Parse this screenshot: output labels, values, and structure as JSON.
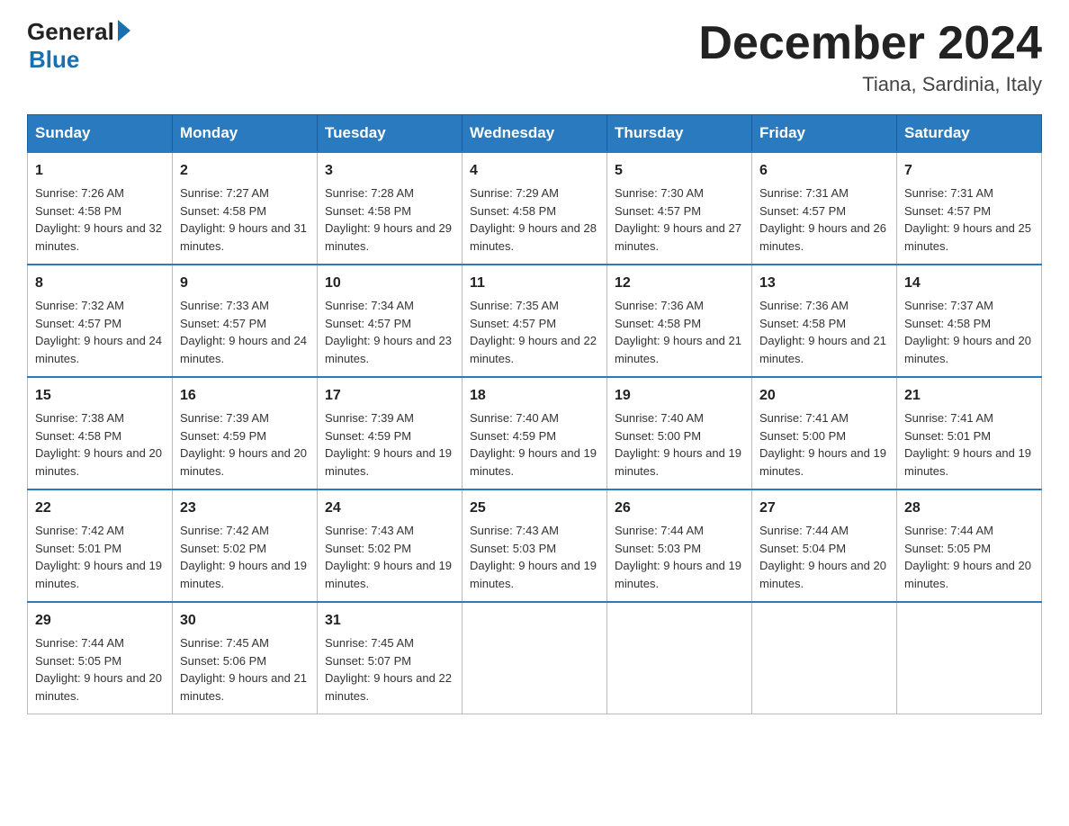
{
  "header": {
    "logo_general": "General",
    "logo_blue": "Blue",
    "month_title": "December 2024",
    "location": "Tiana, Sardinia, Italy"
  },
  "weekdays": [
    "Sunday",
    "Monday",
    "Tuesday",
    "Wednesday",
    "Thursday",
    "Friday",
    "Saturday"
  ],
  "weeks": [
    [
      {
        "day": "1",
        "sunrise": "Sunrise: 7:26 AM",
        "sunset": "Sunset: 4:58 PM",
        "daylight": "Daylight: 9 hours and 32 minutes."
      },
      {
        "day": "2",
        "sunrise": "Sunrise: 7:27 AM",
        "sunset": "Sunset: 4:58 PM",
        "daylight": "Daylight: 9 hours and 31 minutes."
      },
      {
        "day": "3",
        "sunrise": "Sunrise: 7:28 AM",
        "sunset": "Sunset: 4:58 PM",
        "daylight": "Daylight: 9 hours and 29 minutes."
      },
      {
        "day": "4",
        "sunrise": "Sunrise: 7:29 AM",
        "sunset": "Sunset: 4:58 PM",
        "daylight": "Daylight: 9 hours and 28 minutes."
      },
      {
        "day": "5",
        "sunrise": "Sunrise: 7:30 AM",
        "sunset": "Sunset: 4:57 PM",
        "daylight": "Daylight: 9 hours and 27 minutes."
      },
      {
        "day": "6",
        "sunrise": "Sunrise: 7:31 AM",
        "sunset": "Sunset: 4:57 PM",
        "daylight": "Daylight: 9 hours and 26 minutes."
      },
      {
        "day": "7",
        "sunrise": "Sunrise: 7:31 AM",
        "sunset": "Sunset: 4:57 PM",
        "daylight": "Daylight: 9 hours and 25 minutes."
      }
    ],
    [
      {
        "day": "8",
        "sunrise": "Sunrise: 7:32 AM",
        "sunset": "Sunset: 4:57 PM",
        "daylight": "Daylight: 9 hours and 24 minutes."
      },
      {
        "day": "9",
        "sunrise": "Sunrise: 7:33 AM",
        "sunset": "Sunset: 4:57 PM",
        "daylight": "Daylight: 9 hours and 24 minutes."
      },
      {
        "day": "10",
        "sunrise": "Sunrise: 7:34 AM",
        "sunset": "Sunset: 4:57 PM",
        "daylight": "Daylight: 9 hours and 23 minutes."
      },
      {
        "day": "11",
        "sunrise": "Sunrise: 7:35 AM",
        "sunset": "Sunset: 4:57 PM",
        "daylight": "Daylight: 9 hours and 22 minutes."
      },
      {
        "day": "12",
        "sunrise": "Sunrise: 7:36 AM",
        "sunset": "Sunset: 4:58 PM",
        "daylight": "Daylight: 9 hours and 21 minutes."
      },
      {
        "day": "13",
        "sunrise": "Sunrise: 7:36 AM",
        "sunset": "Sunset: 4:58 PM",
        "daylight": "Daylight: 9 hours and 21 minutes."
      },
      {
        "day": "14",
        "sunrise": "Sunrise: 7:37 AM",
        "sunset": "Sunset: 4:58 PM",
        "daylight": "Daylight: 9 hours and 20 minutes."
      }
    ],
    [
      {
        "day": "15",
        "sunrise": "Sunrise: 7:38 AM",
        "sunset": "Sunset: 4:58 PM",
        "daylight": "Daylight: 9 hours and 20 minutes."
      },
      {
        "day": "16",
        "sunrise": "Sunrise: 7:39 AM",
        "sunset": "Sunset: 4:59 PM",
        "daylight": "Daylight: 9 hours and 20 minutes."
      },
      {
        "day": "17",
        "sunrise": "Sunrise: 7:39 AM",
        "sunset": "Sunset: 4:59 PM",
        "daylight": "Daylight: 9 hours and 19 minutes."
      },
      {
        "day": "18",
        "sunrise": "Sunrise: 7:40 AM",
        "sunset": "Sunset: 4:59 PM",
        "daylight": "Daylight: 9 hours and 19 minutes."
      },
      {
        "day": "19",
        "sunrise": "Sunrise: 7:40 AM",
        "sunset": "Sunset: 5:00 PM",
        "daylight": "Daylight: 9 hours and 19 minutes."
      },
      {
        "day": "20",
        "sunrise": "Sunrise: 7:41 AM",
        "sunset": "Sunset: 5:00 PM",
        "daylight": "Daylight: 9 hours and 19 minutes."
      },
      {
        "day": "21",
        "sunrise": "Sunrise: 7:41 AM",
        "sunset": "Sunset: 5:01 PM",
        "daylight": "Daylight: 9 hours and 19 minutes."
      }
    ],
    [
      {
        "day": "22",
        "sunrise": "Sunrise: 7:42 AM",
        "sunset": "Sunset: 5:01 PM",
        "daylight": "Daylight: 9 hours and 19 minutes."
      },
      {
        "day": "23",
        "sunrise": "Sunrise: 7:42 AM",
        "sunset": "Sunset: 5:02 PM",
        "daylight": "Daylight: 9 hours and 19 minutes."
      },
      {
        "day": "24",
        "sunrise": "Sunrise: 7:43 AM",
        "sunset": "Sunset: 5:02 PM",
        "daylight": "Daylight: 9 hours and 19 minutes."
      },
      {
        "day": "25",
        "sunrise": "Sunrise: 7:43 AM",
        "sunset": "Sunset: 5:03 PM",
        "daylight": "Daylight: 9 hours and 19 minutes."
      },
      {
        "day": "26",
        "sunrise": "Sunrise: 7:44 AM",
        "sunset": "Sunset: 5:03 PM",
        "daylight": "Daylight: 9 hours and 19 minutes."
      },
      {
        "day": "27",
        "sunrise": "Sunrise: 7:44 AM",
        "sunset": "Sunset: 5:04 PM",
        "daylight": "Daylight: 9 hours and 20 minutes."
      },
      {
        "day": "28",
        "sunrise": "Sunrise: 7:44 AM",
        "sunset": "Sunset: 5:05 PM",
        "daylight": "Daylight: 9 hours and 20 minutes."
      }
    ],
    [
      {
        "day": "29",
        "sunrise": "Sunrise: 7:44 AM",
        "sunset": "Sunset: 5:05 PM",
        "daylight": "Daylight: 9 hours and 20 minutes."
      },
      {
        "day": "30",
        "sunrise": "Sunrise: 7:45 AM",
        "sunset": "Sunset: 5:06 PM",
        "daylight": "Daylight: 9 hours and 21 minutes."
      },
      {
        "day": "31",
        "sunrise": "Sunrise: 7:45 AM",
        "sunset": "Sunset: 5:07 PM",
        "daylight": "Daylight: 9 hours and 22 minutes."
      },
      null,
      null,
      null,
      null
    ]
  ]
}
